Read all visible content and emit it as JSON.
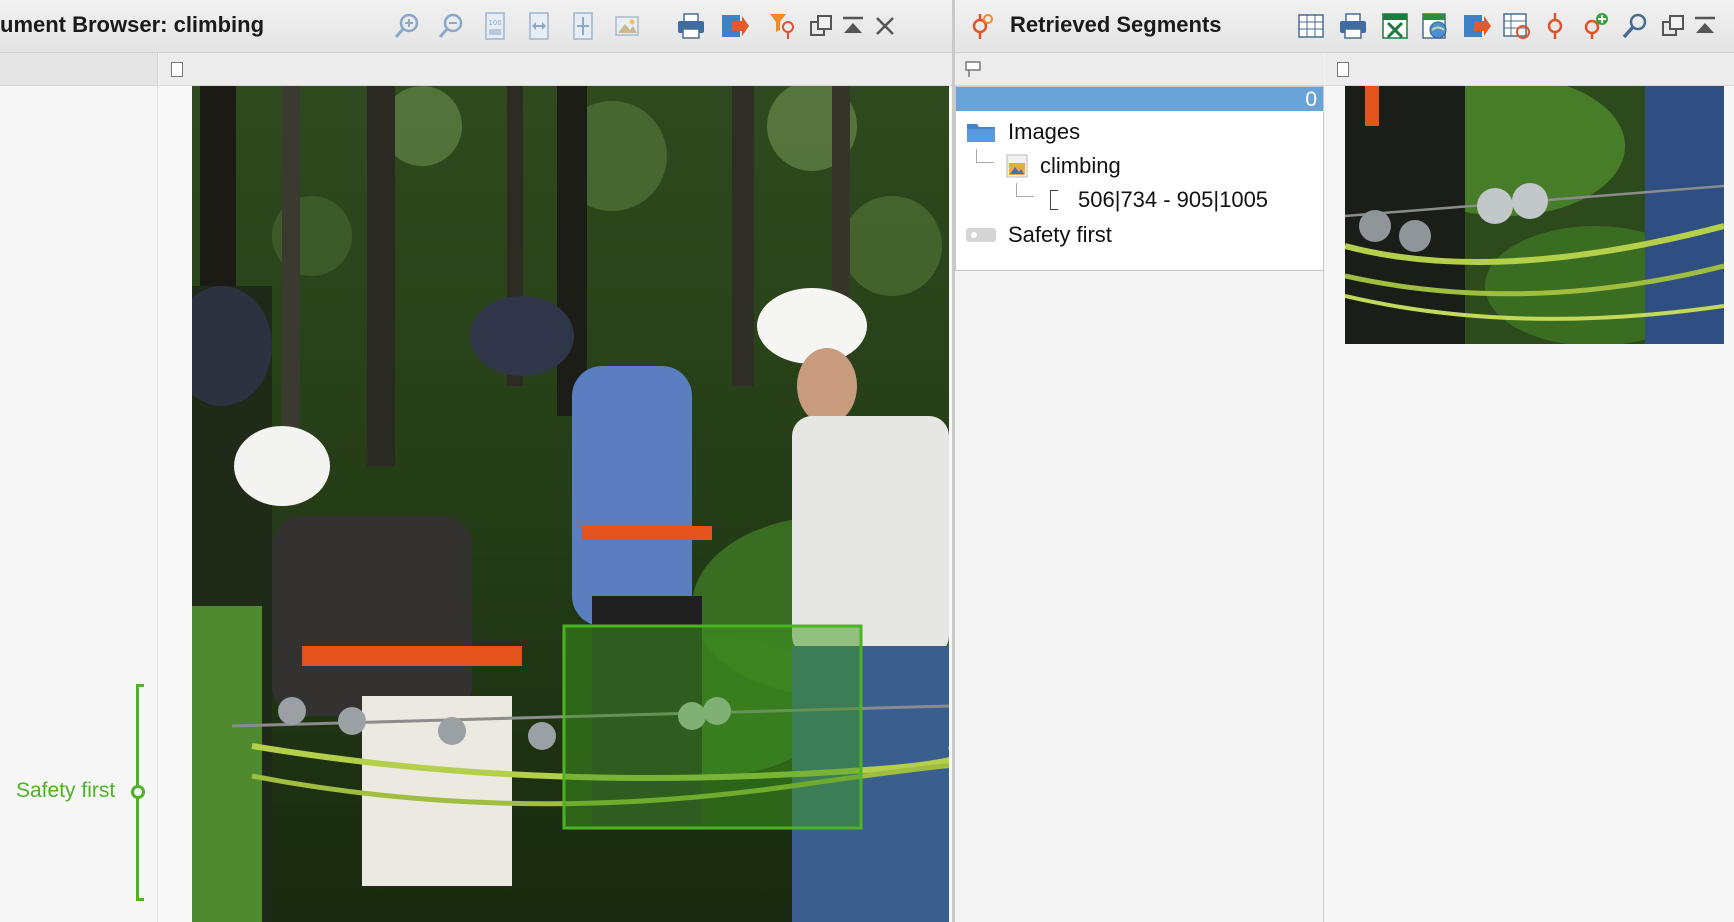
{
  "document_browser": {
    "title": "ument Browser: climbing",
    "toolbar_icons": [
      "zoom-in-icon",
      "zoom-out-icon",
      "zoom-100-icon",
      "fit-width-icon",
      "fit-page-icon",
      "image-settings-icon",
      "print-icon",
      "export-icon",
      "filter-quotation-icon",
      "detach-window-icon",
      "minimize-icon",
      "close-icon"
    ],
    "segment_label": "Safety first",
    "segment_color": "#4cb324"
  },
  "retrieved_segments": {
    "title": "Retrieved Segments",
    "count": "0",
    "toolbar_icons": [
      "table-icon",
      "print-icon",
      "excel-export-icon",
      "web-export-icon",
      "export-icon",
      "table-settings-icon",
      "quotation-icon",
      "add-quotation-icon",
      "search-icon",
      "detach-window-icon",
      "minimize-icon"
    ],
    "tree": {
      "folder_label": "Images",
      "document_label": "climbing",
      "segment_range": "506|734 - 905|1005",
      "code_label": "Safety first"
    },
    "accent_color": "#6aa3d8"
  }
}
